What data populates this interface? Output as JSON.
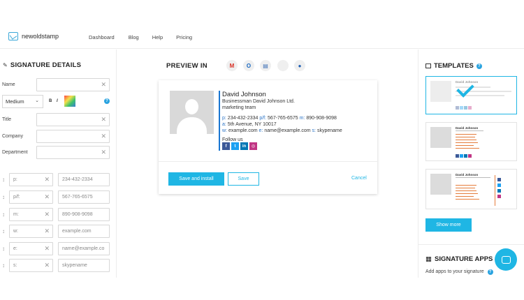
{
  "nav": {
    "logo_text": "newoldstamp",
    "items": [
      "Dashboard",
      "Blog",
      "Help",
      "Pricing"
    ]
  },
  "left": {
    "title": "SIGNATURE DETAILS",
    "fields": [
      {
        "label": "Name",
        "value": ""
      },
      {
        "label": "Title",
        "value": ""
      },
      {
        "label": "Company",
        "value": ""
      },
      {
        "label": "Department",
        "value": ""
      }
    ],
    "font_size_value": "Medium",
    "bold_label": "B",
    "italic_label": "I",
    "help_glyph": "?",
    "contacts": [
      {
        "key": "p:",
        "placeholder": "234-432-2334"
      },
      {
        "key": "p/f:",
        "placeholder": "567-765-6575"
      },
      {
        "key": "m:",
        "placeholder": "890-908-9098"
      },
      {
        "key": "w:",
        "placeholder": "example.com"
      },
      {
        "key": "e:",
        "placeholder": "name@example.co"
      },
      {
        "key": "s:",
        "placeholder": "skypename"
      }
    ]
  },
  "preview": {
    "title": "PREVIEW IN",
    "clients": [
      {
        "icon": "gmail-icon",
        "glyph": "M",
        "color": "#d93025"
      },
      {
        "icon": "outlook-icon",
        "glyph": "O",
        "color": "#1565c0"
      },
      {
        "icon": "apple-mail-icon",
        "glyph": "▤",
        "color": "#3d6fb6"
      },
      {
        "icon": "apple-icon",
        "glyph": "",
        "color": "#222222"
      },
      {
        "icon": "thunderbird-icon",
        "glyph": "●",
        "color": "#1f5fb3"
      }
    ],
    "signature": {
      "name": "David Johnson",
      "position": "Businessman David Johnson Ltd.",
      "department": "marketing team",
      "phone_label": "p:",
      "phone": "234-432-2334",
      "fax_label": "p/f:",
      "fax": "567-765-6575",
      "mobile_label": "m:",
      "mobile": "890-908-9098",
      "address_label": "a:",
      "address": "5th Avenue, NY 10017",
      "web_label": "w:",
      "web": "example.com",
      "email_label": "e:",
      "email": "name@example.com",
      "skype_label": "s:",
      "skype": "skypename",
      "follow": "Follow us",
      "socials": [
        {
          "icon": "facebook-icon",
          "glyph": "f",
          "color": "#3b5998"
        },
        {
          "icon": "twitter-icon",
          "glyph": "t",
          "color": "#1da1f2"
        },
        {
          "icon": "linkedin-icon",
          "glyph": "in",
          "color": "#0077b5"
        },
        {
          "icon": "instagram-icon",
          "glyph": "◎",
          "color": "#c13584"
        }
      ]
    },
    "save_install_label": "Save and install",
    "save_label": "Save",
    "cancel_label": "Cancel"
  },
  "right": {
    "templates_title": "TEMPLATES",
    "help_glyph": "?",
    "template_name": "David Johnson",
    "show_more_label": "Show more",
    "apps_title": "SIGNATURE APPS",
    "apps_sub": "Add apps to your signature"
  },
  "colors": {
    "accent": "#1fb6e4",
    "signature_line": "#1976d2",
    "label_blue": "#2b74c7"
  }
}
